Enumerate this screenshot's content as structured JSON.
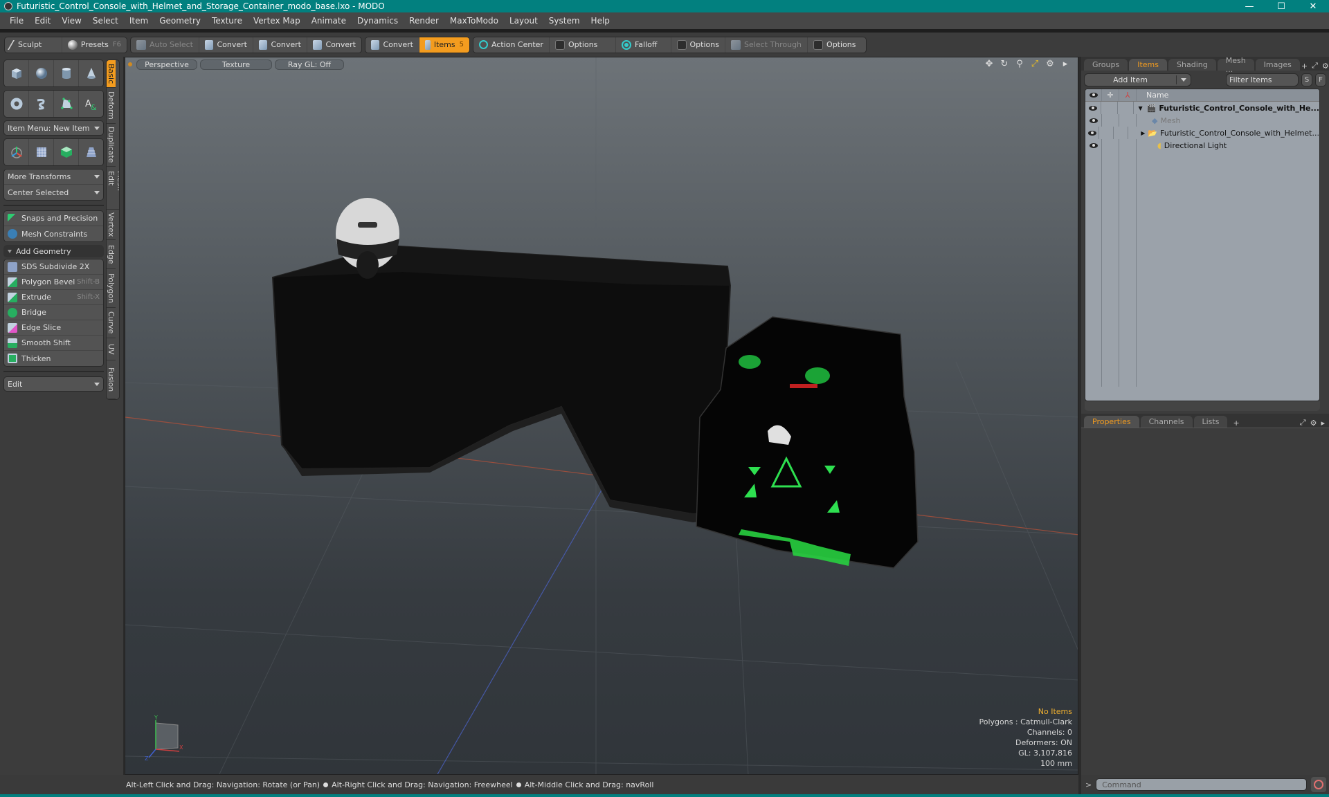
{
  "window": {
    "title": "Futuristic_Control_Console_with_Helmet_and_Storage_Container_modo_base.lxo - MODO",
    "controls": {
      "minimize": "—",
      "maximize": "☐",
      "close": "✕"
    }
  },
  "menu": [
    "File",
    "Edit",
    "View",
    "Select",
    "Item",
    "Geometry",
    "Texture",
    "Vertex Map",
    "Animate",
    "Dynamics",
    "Render",
    "MaxToModo",
    "Layout",
    "System",
    "Help"
  ],
  "toolbar": {
    "sculpt": "Sculpt",
    "presets": "Presets",
    "presets_shortcut": "F6",
    "auto_select": "Auto Select",
    "convert1": "Convert",
    "convert2": "Convert",
    "convert3": "Convert",
    "convert4": "Convert",
    "items": "Items",
    "items_shortcut": "5",
    "action_center": "Action Center",
    "options1": "Options",
    "falloff": "Falloff",
    "options2": "Options",
    "select_through": "Select Through",
    "options3": "Options",
    "accent_color": "#f39c1f"
  },
  "left_panel": {
    "item_menu": "Item Menu: New Item",
    "more_transforms": "More Transforms",
    "center_selected": "Center Selected",
    "snaps": "Snaps and Precision",
    "mesh_constraints": "Mesh Constraints",
    "add_geometry": "Add Geometry",
    "tools": [
      {
        "label": "SDS Subdivide 2X",
        "shortcut": ""
      },
      {
        "label": "Polygon Bevel",
        "shortcut": "Shift-B"
      },
      {
        "label": "Extrude",
        "shortcut": "Shift-X"
      },
      {
        "label": "Bridge",
        "shortcut": ""
      },
      {
        "label": "Edge Slice",
        "shortcut": ""
      },
      {
        "label": "Smooth Shift",
        "shortcut": ""
      },
      {
        "label": "Thicken",
        "shortcut": ""
      }
    ],
    "edit": "Edit",
    "vertical_tabs": [
      "Basic",
      "Deform",
      "Duplicate",
      "Mesh Edit",
      "Vertex",
      "Edge",
      "Polygon",
      "Curve",
      "UV",
      "Fusion"
    ],
    "active_tab": "Basic"
  },
  "viewport": {
    "view": "Perspective",
    "shading": "Texture",
    "raygl": "Ray GL: Off",
    "info": {
      "selection": "No Items",
      "polygons": "Polygons : Catmull-Clark",
      "channels": "Channels: 0",
      "deformers": "Deformers: ON",
      "gl": "GL: 3,107,816",
      "unit": "100 mm"
    },
    "axes": {
      "x": "X",
      "y": "Y",
      "z": "Z"
    }
  },
  "right_panel": {
    "tabs": [
      "Groups",
      "Items",
      "Shading",
      "Mesh ...",
      "Images"
    ],
    "active_tab": "Items",
    "add_item": "Add Item",
    "filter_placeholder": "Filter Items",
    "s_btn": "S",
    "f_btn": "F",
    "column_name": "Name",
    "tree": [
      {
        "label": "Futuristic_Control_Console_with_He...",
        "bold": true,
        "level": 0
      },
      {
        "label": "Mesh",
        "dim": true,
        "level": 1
      },
      {
        "label": "Futuristic_Control_Console_with_Helmet...",
        "level": 1
      },
      {
        "label": "Directional Light",
        "level": 1
      }
    ],
    "props_tabs": [
      "Properties",
      "Channels",
      "Lists"
    ],
    "props_active": "Properties"
  },
  "status": {
    "hint1": "Alt-Left Click and Drag: Navigation: Rotate (or Pan)",
    "hint2": "Alt-Right Click and Drag: Navigation: Freewheel",
    "hint3": "Alt-Middle Click and Drag: navRoll",
    "command_placeholder": "Command",
    "prompt": ">"
  }
}
